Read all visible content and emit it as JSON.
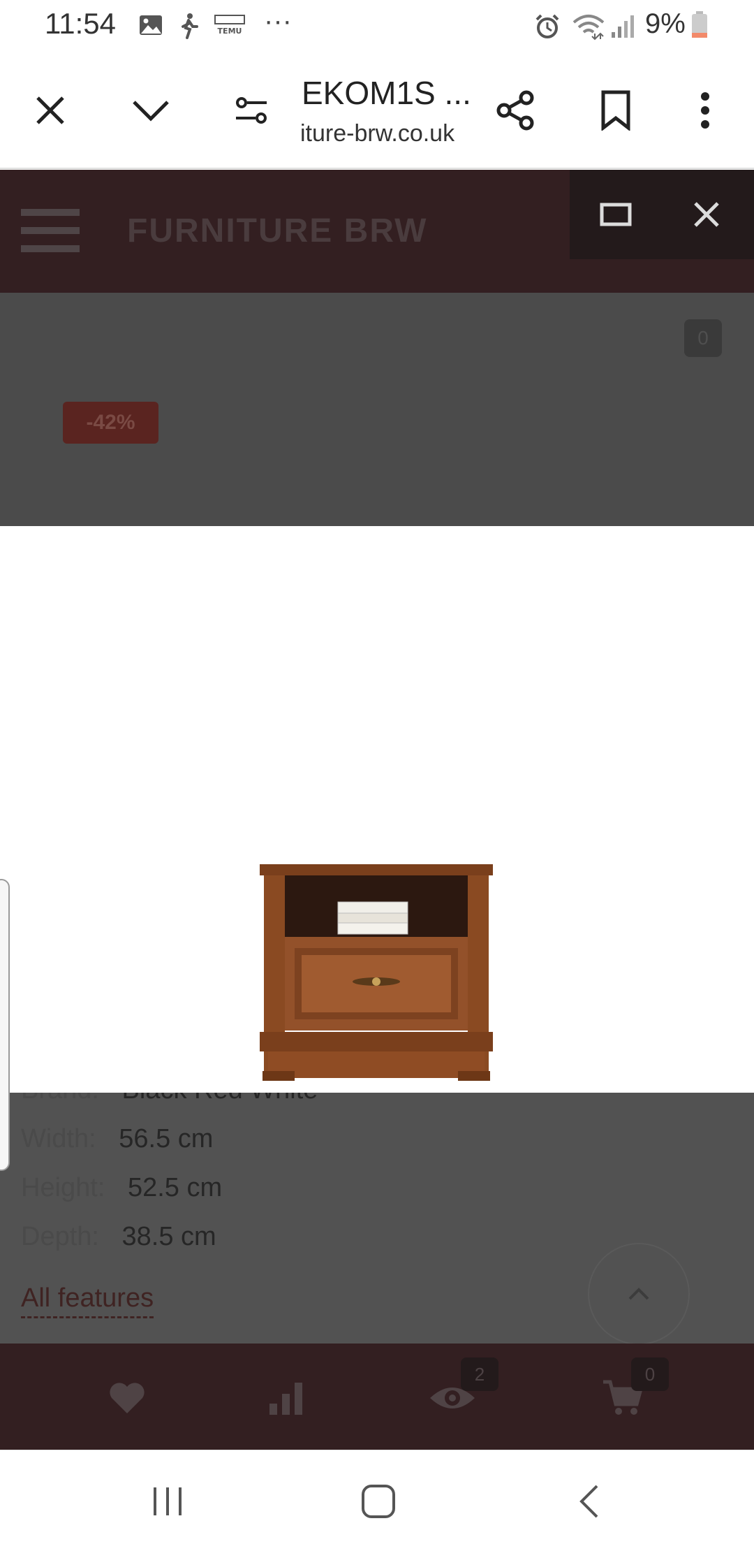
{
  "status_bar": {
    "time": "11:54",
    "more": "···",
    "battery": "9%",
    "icons": [
      "gallery-icon",
      "walking-icon",
      "temu-icon",
      "alarm-icon",
      "wifi-icon",
      "signal-icon",
      "battery-icon"
    ]
  },
  "browser": {
    "title": "EKOM1S ...",
    "url": "iture-brw.co.uk",
    "icons": [
      "close-icon",
      "chevron-down-icon",
      "tune-icon",
      "share-icon",
      "bookmark-icon",
      "more-vert-icon"
    ]
  },
  "site": {
    "logo": "FURNITURE BRW",
    "compare_count": "0",
    "discount": "-42%"
  },
  "specs": [
    {
      "label": "Brand:",
      "value": "Black Red White"
    },
    {
      "label": "Width:",
      "value": "56.5 cm"
    },
    {
      "label": "Height:",
      "value": "52.5 cm"
    },
    {
      "label": "Depth:",
      "value": "38.5 cm"
    }
  ],
  "all_features": "All features",
  "bottom_nav": {
    "viewed_count": "2",
    "cart_count": "0",
    "icons": [
      "heart-icon",
      "bar-chart-icon",
      "eye-icon",
      "cart-icon"
    ]
  },
  "colors": {
    "header": "#331f21",
    "overlay": "#525252",
    "badge": "#5a2420"
  }
}
